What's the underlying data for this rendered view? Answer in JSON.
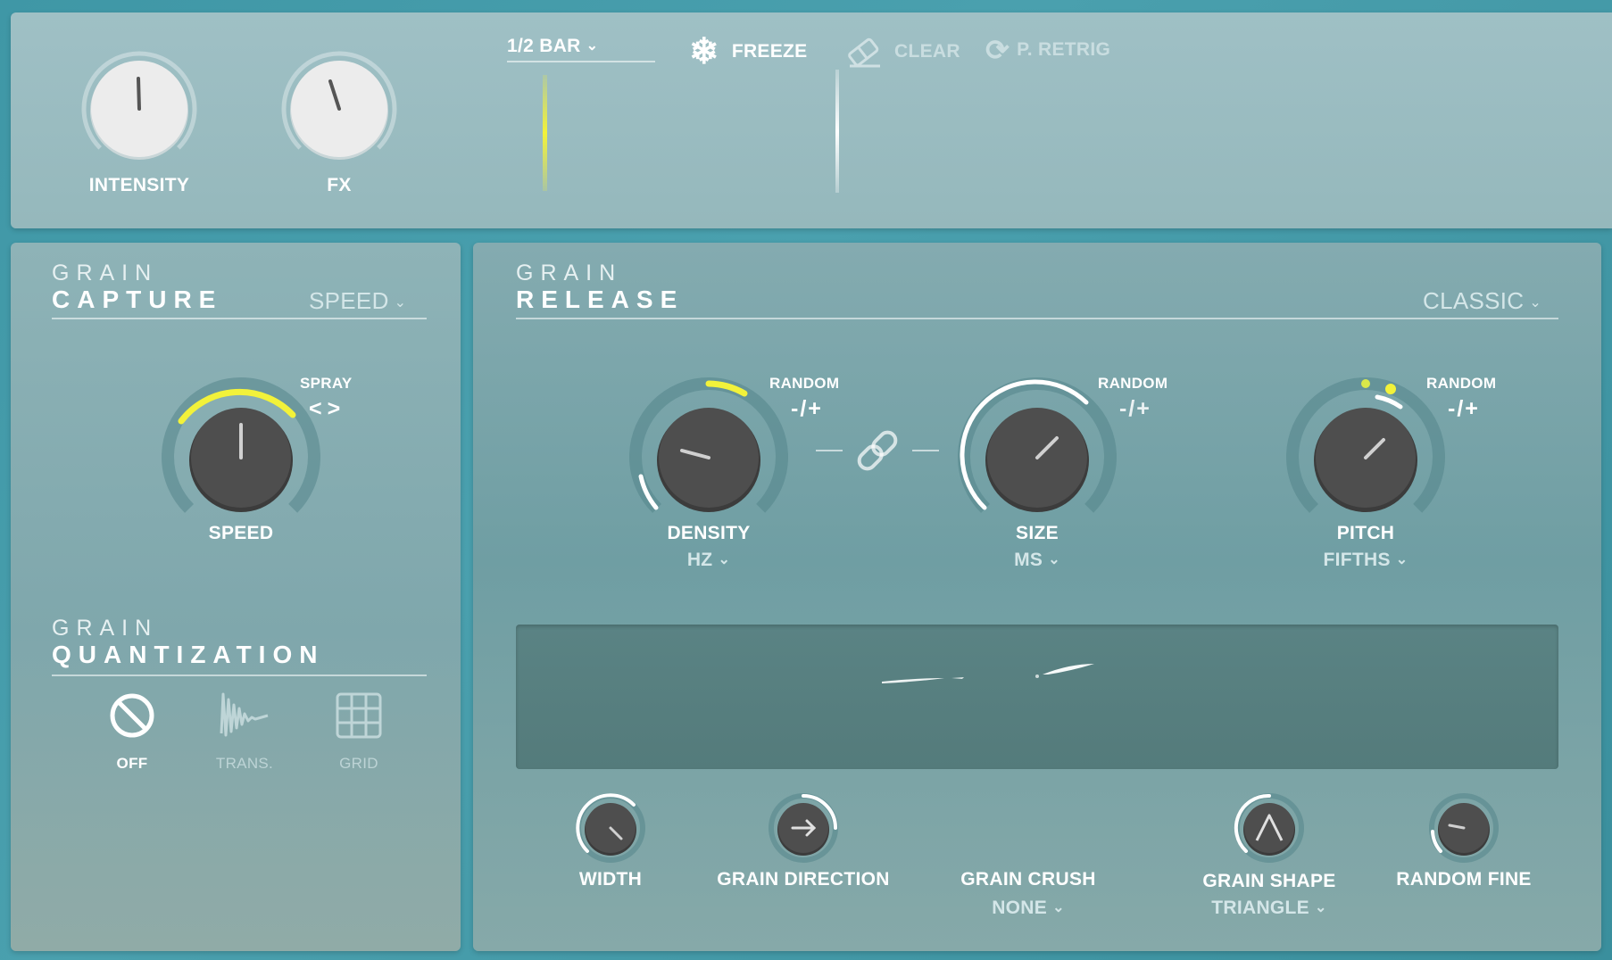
{
  "top": {
    "intensity_label": "INTENSITY",
    "fx_label": "FX",
    "bar_select": "1/2 BAR",
    "freeze_label": "FREEZE",
    "clear_label": "CLEAR",
    "retrig_label": "P. RETRIG"
  },
  "capture": {
    "title_small": "GRAIN",
    "title_big": "CAPTURE",
    "mode": "SPEED",
    "spray_label": "SPRAY",
    "spray_arrows": "<>",
    "speed_label": "SPEED"
  },
  "quantization": {
    "title_small": "GRAIN",
    "title_big": "QUANTIZATION",
    "options": [
      {
        "label": "OFF",
        "icon": "off-icon",
        "selected": true
      },
      {
        "label": "TRANS.",
        "icon": "transient-icon",
        "selected": false
      },
      {
        "label": "GRID",
        "icon": "grid-icon",
        "selected": false
      }
    ]
  },
  "release": {
    "title_small": "GRAIN",
    "title_big": "RELEASE",
    "mode": "CLASSIC",
    "random_label": "RANDOM",
    "random_symbol": "-/+",
    "knobs": [
      {
        "label": "DENSITY",
        "unit": "HZ"
      },
      {
        "label": "SIZE",
        "unit": "MS"
      },
      {
        "label": "PITCH",
        "unit": "FIFTHS"
      }
    ],
    "bottom": {
      "width_label": "WIDTH",
      "direction_label": "GRAIN DIRECTION",
      "crush_label": "GRAIN CRUSH",
      "crush_value": "NONE",
      "shape_label": "GRAIN SHAPE",
      "shape_value": "TRIANGLE",
      "random_fine_label": "RANDOM FINE"
    }
  },
  "colors": {
    "accent_yellow": "#f2f23a",
    "knob_dark": "#4a4a4a",
    "knob_light": "#ececec"
  }
}
